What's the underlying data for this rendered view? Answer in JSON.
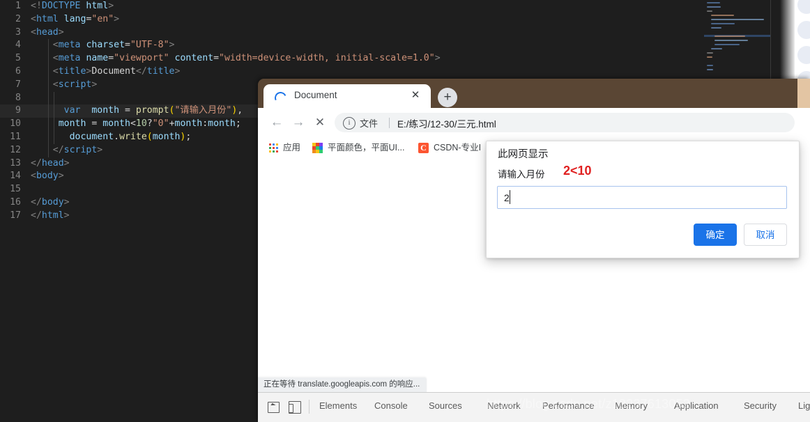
{
  "editor": {
    "lines": [
      {
        "n": "1",
        "tokens": [
          {
            "c": "t-ang",
            "t": "<!"
          },
          {
            "c": "t-tag",
            "t": "DOCTYPE"
          },
          {
            "c": "t-plain",
            "t": " "
          },
          {
            "c": "t-attr",
            "t": "html"
          },
          {
            "c": "t-ang",
            "t": ">"
          }
        ],
        "indent": 0,
        "current": false
      },
      {
        "n": "2",
        "tokens": [
          {
            "c": "t-ang",
            "t": "<"
          },
          {
            "c": "t-tag",
            "t": "html"
          },
          {
            "c": "t-plain",
            "t": " "
          },
          {
            "c": "t-attr",
            "t": "lang"
          },
          {
            "c": "t-plain",
            "t": "="
          },
          {
            "c": "t-str",
            "t": "\"en\""
          },
          {
            "c": "t-ang",
            "t": ">"
          }
        ],
        "indent": 0,
        "current": false
      },
      {
        "n": "3",
        "tokens": [
          {
            "c": "t-ang",
            "t": "<"
          },
          {
            "c": "t-tag",
            "t": "head"
          },
          {
            "c": "t-ang",
            "t": ">"
          }
        ],
        "indent": 0,
        "current": false
      },
      {
        "n": "4",
        "tokens": [
          {
            "c": "t-plain",
            "t": "    "
          },
          {
            "c": "t-ang",
            "t": "<"
          },
          {
            "c": "t-tag",
            "t": "meta"
          },
          {
            "c": "t-plain",
            "t": " "
          },
          {
            "c": "t-attr",
            "t": "charset"
          },
          {
            "c": "t-plain",
            "t": "="
          },
          {
            "c": "t-str",
            "t": "\"UTF-8\""
          },
          {
            "c": "t-ang",
            "t": ">"
          }
        ],
        "indent": 1,
        "current": false
      },
      {
        "n": "5",
        "tokens": [
          {
            "c": "t-plain",
            "t": "    "
          },
          {
            "c": "t-ang",
            "t": "<"
          },
          {
            "c": "t-tag",
            "t": "meta"
          },
          {
            "c": "t-plain",
            "t": " "
          },
          {
            "c": "t-attr",
            "t": "name"
          },
          {
            "c": "t-plain",
            "t": "="
          },
          {
            "c": "t-str",
            "t": "\"viewport\""
          },
          {
            "c": "t-plain",
            "t": " "
          },
          {
            "c": "t-attr",
            "t": "content"
          },
          {
            "c": "t-plain",
            "t": "="
          },
          {
            "c": "t-str",
            "t": "\"width=device-width, initial-scale=1.0\""
          },
          {
            "c": "t-ang",
            "t": ">"
          }
        ],
        "indent": 1,
        "current": false
      },
      {
        "n": "6",
        "tokens": [
          {
            "c": "t-plain",
            "t": "    "
          },
          {
            "c": "t-ang",
            "t": "<"
          },
          {
            "c": "t-tag",
            "t": "title"
          },
          {
            "c": "t-ang",
            "t": ">"
          },
          {
            "c": "t-plain",
            "t": "Document"
          },
          {
            "c": "t-ang",
            "t": "</"
          },
          {
            "c": "t-tag",
            "t": "title"
          },
          {
            "c": "t-ang",
            "t": ">"
          }
        ],
        "indent": 1,
        "current": false
      },
      {
        "n": "7",
        "tokens": [
          {
            "c": "t-plain",
            "t": "    "
          },
          {
            "c": "t-ang",
            "t": "<"
          },
          {
            "c": "t-tag",
            "t": "script"
          },
          {
            "c": "t-ang",
            "t": ">"
          }
        ],
        "indent": 1,
        "current": false
      },
      {
        "n": "8",
        "tokens": [],
        "indent": 2,
        "current": false
      },
      {
        "n": "9",
        "tokens": [
          {
            "c": "t-plain",
            "t": "      "
          },
          {
            "c": "t-kw",
            "t": "var"
          },
          {
            "c": "t-plain",
            "t": "  "
          },
          {
            "c": "t-var",
            "t": "month"
          },
          {
            "c": "t-plain",
            "t": " = "
          },
          {
            "c": "t-fn",
            "t": "prompt"
          },
          {
            "c": "t-paren",
            "t": "("
          },
          {
            "c": "t-str",
            "t": "\"请输入月份\""
          },
          {
            "c": "t-paren",
            "t": ")"
          },
          {
            "c": "t-plain",
            "t": ","
          }
        ],
        "indent": 2,
        "current": true
      },
      {
        "n": "10",
        "tokens": [
          {
            "c": "t-plain",
            "t": "     "
          },
          {
            "c": "t-var",
            "t": "month"
          },
          {
            "c": "t-plain",
            "t": " = "
          },
          {
            "c": "t-var",
            "t": "month"
          },
          {
            "c": "t-plain",
            "t": "<"
          },
          {
            "c": "t-num",
            "t": "10"
          },
          {
            "c": "t-plain",
            "t": "?"
          },
          {
            "c": "t-str",
            "t": "\"0\""
          },
          {
            "c": "t-plain",
            "t": "+"
          },
          {
            "c": "t-var",
            "t": "month"
          },
          {
            "c": "t-plain",
            "t": ":"
          },
          {
            "c": "t-var",
            "t": "month"
          },
          {
            "c": "t-plain",
            "t": ";"
          }
        ],
        "indent": 2,
        "current": false
      },
      {
        "n": "11",
        "tokens": [
          {
            "c": "t-plain",
            "t": "       "
          },
          {
            "c": "t-var",
            "t": "document"
          },
          {
            "c": "t-plain",
            "t": "."
          },
          {
            "c": "t-fn",
            "t": "write"
          },
          {
            "c": "t-paren",
            "t": "("
          },
          {
            "c": "t-var",
            "t": "month"
          },
          {
            "c": "t-paren",
            "t": ")"
          },
          {
            "c": "t-plain",
            "t": ";"
          }
        ],
        "indent": 2,
        "current": false
      },
      {
        "n": "12",
        "tokens": [
          {
            "c": "t-plain",
            "t": "    "
          },
          {
            "c": "t-ang",
            "t": "</"
          },
          {
            "c": "t-tag",
            "t": "script"
          },
          {
            "c": "t-ang",
            "t": ">"
          }
        ],
        "indent": 1,
        "current": false
      },
      {
        "n": "13",
        "tokens": [
          {
            "c": "t-ang",
            "t": "</"
          },
          {
            "c": "t-tag",
            "t": "head"
          },
          {
            "c": "t-ang",
            "t": ">"
          }
        ],
        "indent": 0,
        "current": false
      },
      {
        "n": "14",
        "tokens": [
          {
            "c": "t-ang",
            "t": "<"
          },
          {
            "c": "t-tag",
            "t": "body"
          },
          {
            "c": "t-ang",
            "t": ">"
          }
        ],
        "indent": 0,
        "current": false
      },
      {
        "n": "15",
        "tokens": [],
        "indent": 0,
        "current": false
      },
      {
        "n": "16",
        "tokens": [
          {
            "c": "t-ang",
            "t": "</"
          },
          {
            "c": "t-tag",
            "t": "body"
          },
          {
            "c": "t-ang",
            "t": ">"
          }
        ],
        "indent": 0,
        "current": false
      },
      {
        "n": "17",
        "tokens": [
          {
            "c": "t-ang",
            "t": "</"
          },
          {
            "c": "t-tag",
            "t": "html"
          },
          {
            "c": "t-ang",
            "t": ">"
          }
        ],
        "indent": 0,
        "current": false
      }
    ]
  },
  "browser": {
    "tab": {
      "title": "Document",
      "close_label": "✕",
      "loading": true
    },
    "new_tab_label": "+",
    "nav": {
      "back": "←",
      "forward": "→",
      "stop": "✕"
    },
    "omnibox": {
      "info_glyph": "i",
      "scheme_label": "文件",
      "url": "E:/练习/12-30/三元.html"
    },
    "bookmarks": [
      {
        "label": "应用",
        "icon": "apps-grid-icon"
      },
      {
        "label": "平面颜色，平面UI...",
        "icon": "color-palette-icon"
      },
      {
        "label": "CSDN-专业I",
        "icon": "csdn-icon",
        "icon_letter": "C"
      }
    ],
    "status_text": "正在等待 translate.googleapis.com 的响应...",
    "titlebar_color": "#5a4634"
  },
  "devtools": {
    "inspect_icon": "inspect-element-icon",
    "device_icon": "device-toolbar-icon",
    "tabs": [
      {
        "label": "Elements"
      },
      {
        "label": "Console"
      },
      {
        "label": "Sources"
      },
      {
        "label": "Network"
      },
      {
        "label": "Performance"
      },
      {
        "label": "Memory"
      },
      {
        "label": "Application"
      },
      {
        "label": "Security"
      },
      {
        "label": "Lighthou"
      }
    ]
  },
  "dialog": {
    "title": "此网页显示",
    "message": "请输入月份",
    "annotation": "2<10",
    "annotation_color": "#e02020",
    "input_value": "2",
    "ok_label": "确定",
    "cancel_label": "取消",
    "ok_color": "#1a73e8"
  },
  "watermark": {
    "text": "https://blog.csdn.net/z18237613052"
  }
}
